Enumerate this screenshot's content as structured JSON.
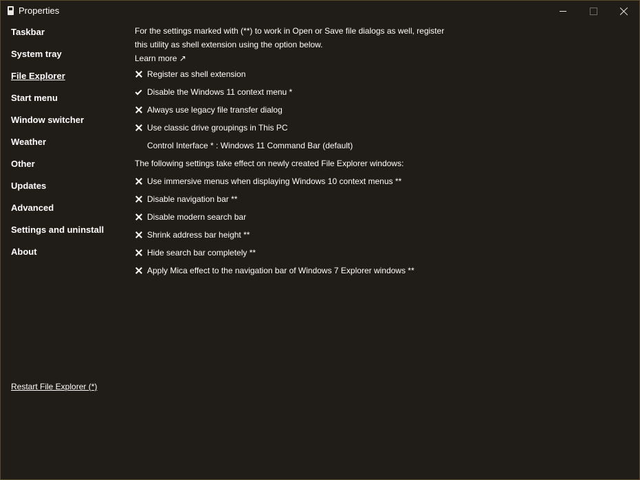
{
  "window": {
    "title": "Properties",
    "icon": "app-document-icon"
  },
  "sidebar": {
    "items": [
      {
        "label": "Taskbar"
      },
      {
        "label": "System tray"
      },
      {
        "label": "File Explorer",
        "active": true
      },
      {
        "label": "Start menu"
      },
      {
        "label": "Window switcher"
      },
      {
        "label": "Weather"
      },
      {
        "label": "Other"
      },
      {
        "label": "Updates"
      },
      {
        "label": "Advanced"
      },
      {
        "label": "Settings and uninstall"
      },
      {
        "label": "About"
      }
    ],
    "restart_link": "Restart File Explorer (*)"
  },
  "main": {
    "intro_line1": "For the settings marked with (**) to work in Open or Save file dialogs as well, register",
    "intro_line2": "this utility as shell extension using the option below.",
    "learn_more": "Learn more ↗",
    "options": [
      {
        "label": "Register as shell extension",
        "checked": false
      },
      {
        "label": "Disable the Windows 11 context menu *",
        "checked": true
      },
      {
        "label": "Always use legacy file transfer dialog",
        "checked": false
      },
      {
        "label": "Use classic drive groupings in This PC",
        "checked": false
      }
    ],
    "control_interface": "Control Interface * : Windows 11 Command Bar (default)",
    "section_text": "The following settings take effect on newly created File Explorer windows:",
    "options2": [
      {
        "label": "Use immersive menus when displaying Windows 10 context menus **",
        "checked": false
      },
      {
        "label": "Disable navigation bar **",
        "checked": false
      },
      {
        "label": "Disable modern search bar",
        "checked": false
      },
      {
        "label": "Shrink address bar height **",
        "checked": false
      },
      {
        "label": "Hide search bar completely **",
        "checked": false
      },
      {
        "label": "Apply Mica effect to the navigation bar of Windows 7 Explorer windows **",
        "checked": false
      }
    ]
  },
  "colors": {
    "background": "#201c17",
    "text": "#ffffff",
    "border": "#5a4a30"
  }
}
